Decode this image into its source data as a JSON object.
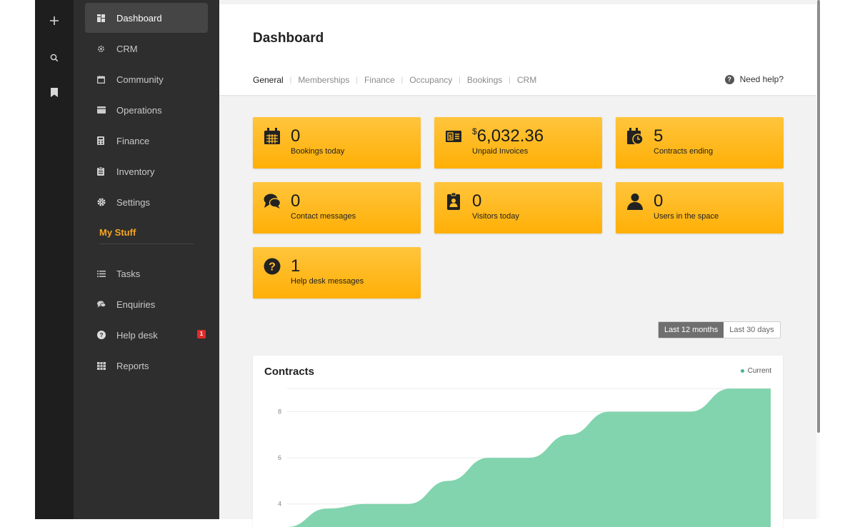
{
  "colors": {
    "accent": "#ffb515",
    "sidebar": "#2e2e2e",
    "chart_fill": "#82d4ae",
    "badge": "#e02b2b"
  },
  "rail": {
    "icons": [
      "plus-icon",
      "search-icon",
      "bookmark-icon"
    ]
  },
  "sidebar": {
    "items": [
      {
        "label": "Dashboard",
        "icon": "dashboard-icon"
      },
      {
        "label": "CRM",
        "icon": "crm-gear-icon"
      },
      {
        "label": "Community",
        "icon": "community-icon"
      },
      {
        "label": "Operations",
        "icon": "operations-icon"
      },
      {
        "label": "Finance",
        "icon": "finance-icon"
      },
      {
        "label": "Inventory",
        "icon": "inventory-icon"
      },
      {
        "label": "Settings",
        "icon": "settings-gear-icon"
      }
    ],
    "section_title": "My Stuff",
    "my_items": [
      {
        "label": "Tasks",
        "icon": "tasks-list-icon"
      },
      {
        "label": "Enquiries",
        "icon": "enquiries-chat-icon"
      },
      {
        "label": "Help desk",
        "icon": "help-desk-icon",
        "badge": "1"
      },
      {
        "label": "Reports",
        "icon": "reports-grid-icon"
      }
    ]
  },
  "header": {
    "title": "Dashboard",
    "tabs": [
      "General",
      "Memberships",
      "Finance",
      "Occupancy",
      "Bookings",
      "CRM"
    ],
    "help": "Need help?"
  },
  "cards": [
    {
      "value": "0",
      "label": "Bookings today",
      "icon": "calendar-icon"
    },
    {
      "currency": "$",
      "value": "6,032.36",
      "label": "Unpaid Invoices",
      "icon": "invoice-icon"
    },
    {
      "value": "5",
      "label": "Contracts ending",
      "icon": "contract-clock-icon"
    },
    {
      "value": "0",
      "label": "Contact messages",
      "icon": "chat-bubbles-icon"
    },
    {
      "value": "0",
      "label": "Visitors today",
      "icon": "visitor-badge-icon"
    },
    {
      "value": "0",
      "label": "Users in the space",
      "icon": "user-icon"
    },
    {
      "value": "1",
      "label": "Help desk messages",
      "icon": "question-circle-icon"
    }
  ],
  "range": {
    "options": [
      "Last 12 months",
      "Last 30 days"
    ],
    "selected": "Last 12 months"
  },
  "chart_data": {
    "type": "area",
    "title": "Contracts",
    "series": [
      {
        "name": "Current",
        "values": [
          3,
          3.8,
          4,
          4,
          5,
          6,
          6,
          7,
          8,
          8,
          8,
          9,
          9
        ]
      }
    ],
    "y_ticks": [
      4,
      6,
      8
    ],
    "ylim": [
      3,
      9.5
    ],
    "grid": true,
    "legend": "top-right"
  }
}
